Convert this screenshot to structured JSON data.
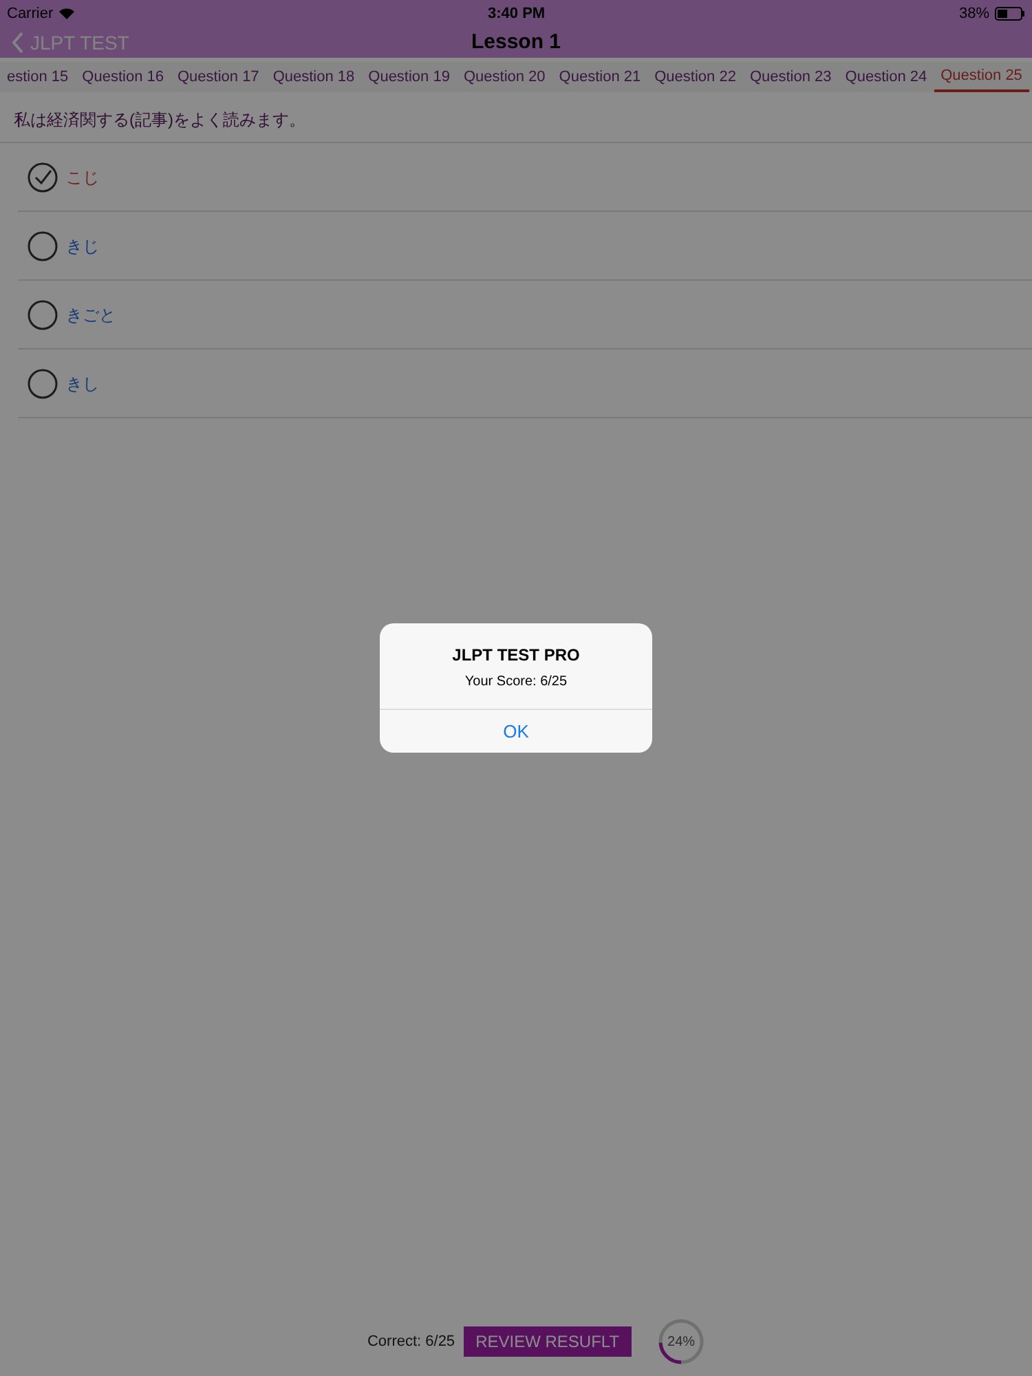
{
  "status_bar": {
    "carrier": "Carrier",
    "time": "3:40 PM",
    "battery": "38%"
  },
  "nav": {
    "back": "JLPT TEST",
    "title": "Lesson 1"
  },
  "tabs": [
    {
      "label": "estion 15",
      "selected": false
    },
    {
      "label": "Question 16",
      "selected": false
    },
    {
      "label": "Question 17",
      "selected": false
    },
    {
      "label": "Question 18",
      "selected": false
    },
    {
      "label": "Question 19",
      "selected": false
    },
    {
      "label": "Question 20",
      "selected": false
    },
    {
      "label": "Question 21",
      "selected": false
    },
    {
      "label": "Question 22",
      "selected": false
    },
    {
      "label": "Question 23",
      "selected": false
    },
    {
      "label": "Question 24",
      "selected": false
    },
    {
      "label": "Question 25",
      "selected": true
    }
  ],
  "question": "私は経済関する(記事)をよく読みます。",
  "options": [
    {
      "label": "こじ",
      "selected": true
    },
    {
      "label": "きじ",
      "selected": false
    },
    {
      "label": "きごと",
      "selected": false
    },
    {
      "label": "きし",
      "selected": false
    }
  ],
  "footer": {
    "correct": "Correct: 6/25",
    "button": "REVIEW RESUFLT",
    "progress": {
      "level": 0.24,
      "reading": "24%"
    }
  },
  "alert": {
    "title": "JLPT TEST PRO",
    "message": "Your Score: 6/25",
    "button": "OK"
  }
}
